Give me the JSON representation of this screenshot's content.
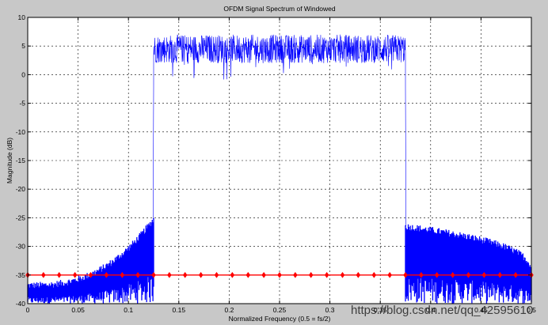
{
  "window": {
    "background": "#c8c8c8"
  },
  "chart_data": {
    "type": "line",
    "title": "OFDM Signal Spectrum of Windowed",
    "xlabel": "Normalized Frequency (0.5 = fs/2)",
    "ylabel": "Magnitude (dB)",
    "xlim": [
      0,
      0.5
    ],
    "ylim": [
      -40,
      10
    ],
    "xticks": [
      0,
      0.05,
      0.1,
      0.15,
      0.2,
      0.25,
      0.3,
      0.35,
      0.4,
      0.45,
      0.5
    ],
    "xtick_labels": [
      "0",
      "0.05",
      "0.1",
      "0.15",
      "0.2",
      "0.25",
      "0.3",
      "0.35",
      "0.4",
      "0.45",
      "0.5"
    ],
    "yticks": [
      10,
      5,
      0,
      -5,
      -10,
      -15,
      -20,
      -25,
      -30,
      -35,
      -40
    ],
    "grid": true,
    "series": [
      {
        "color": "#0000ff",
        "style": "noisy-line",
        "passband": {
          "x_start": 0.125,
          "x_end": 0.375,
          "level_min": -1,
          "level_max": 9.8,
          "mean": 4.5
        },
        "skirts": [
          {
            "x": [
              0.0,
              0.125
            ],
            "y_top": [
              -36.8,
              -25.2
            ],
            "y_bottom": -40
          },
          {
            "x": [
              0.375,
              0.5
            ],
            "y_top": [
              -26.5,
              -35
            ],
            "y_bottom": -40
          }
        ]
      },
      {
        "color": "#ff0000",
        "style": "diamond-markers",
        "y": -35,
        "x": [
          0,
          0.0156,
          0.0312,
          0.0469,
          0.0625,
          0.0781,
          0.0938,
          0.1094,
          0.125,
          0.1406,
          0.1562,
          0.1719,
          0.1875,
          0.2031,
          0.2188,
          0.2344,
          0.25,
          0.2656,
          0.2812,
          0.2969,
          0.3125,
          0.3281,
          0.3438,
          0.3594,
          0.375,
          0.3906,
          0.4062,
          0.4219,
          0.4375,
          0.4531,
          0.4688,
          0.4844,
          0.5
        ]
      }
    ]
  },
  "watermark": "https://blog.csdn.net/qq_42595610"
}
